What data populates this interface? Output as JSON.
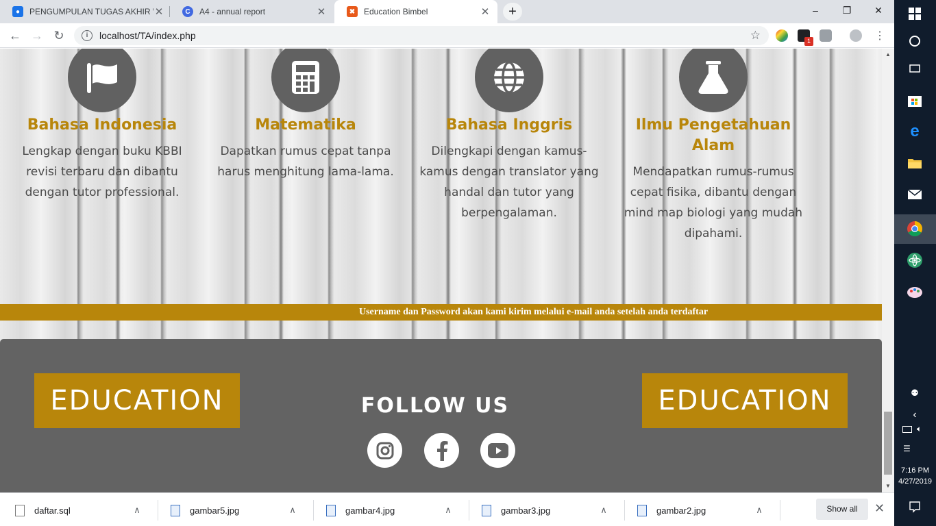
{
  "browser": {
    "tabs": [
      {
        "title": "PENGUMPULAN TUGAS AKHIR W",
        "favicon_color": "#1a73e8"
      },
      {
        "title": "A4 - annual report",
        "favicon_color": "#4169e1"
      },
      {
        "title": "Education Bimbel",
        "favicon_color": "#e8591a"
      }
    ],
    "url": "localhost/TA/index.php"
  },
  "features": [
    {
      "title": "Bahasa Indonesia",
      "description": "Lengkap dengan buku KBBI revisi terbaru dan dibantu dengan tutor professional.",
      "icon": "flag-icon"
    },
    {
      "title": "Matematika",
      "description": "Dapatkan rumus cepat tanpa harus menghitung lama-lama.",
      "icon": "calculator-icon"
    },
    {
      "title": "Bahasa Inggris",
      "description": "Dilengkapi dengan kamus-kamus dengan translator yang handal dan tutor yang berpengalaman.",
      "icon": "globe-icon"
    },
    {
      "title": "Ilmu Pengetahuan Alam",
      "description": "Mendapatkan rumus-rumus cepat fisika, dibantu dengan mind map biologi yang mudah dipahami.",
      "icon": "flask-icon"
    }
  ],
  "marquee": "Username dan Password akan kami kirim melalui e-mail anda setelah anda terdaftar",
  "footer": {
    "logo_left": "EDUCATION",
    "logo_right": "EDUCATION",
    "follow_title": "FOLLOW US",
    "social": [
      "instagram-icon",
      "facebook-icon",
      "youtube-icon"
    ]
  },
  "downloads": [
    {
      "name": "daftar.sql",
      "type": "file"
    },
    {
      "name": "gambar5.jpg",
      "type": "image"
    },
    {
      "name": "gambar4.jpg",
      "type": "image"
    },
    {
      "name": "gambar3.jpg",
      "type": "image"
    },
    {
      "name": "gambar2.jpg",
      "type": "image"
    }
  ],
  "downloads_show_all": "Show all",
  "taskbar": {
    "time": "7:16 PM",
    "date": "4/27/2019"
  },
  "colors": {
    "accent": "#b8860b",
    "footer": "#636363",
    "icon_circle": "#616161"
  }
}
